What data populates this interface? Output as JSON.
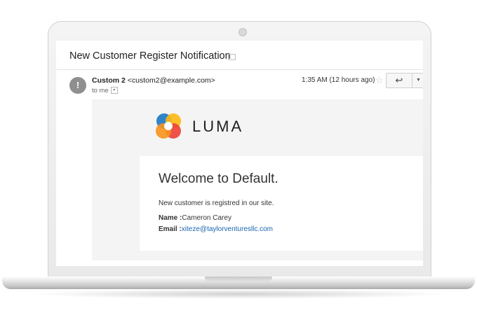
{
  "email": {
    "subject": "New Customer Register Notification",
    "label_icon": "label-icon",
    "avatar_icon": "exclamation-icon",
    "avatar_glyph": "!",
    "sender_name": "Custom 2",
    "sender_email": "<custom2@example.com>",
    "to_line": "to me",
    "time": "1:35 AM (12 hours ago)",
    "star_icon": "star-icon",
    "reply_icon": "reply-icon",
    "more_icon": "dropdown-caret-icon"
  },
  "body": {
    "logo_text": "LUMA",
    "logo_colors": [
      "#1979c3",
      "#f7941d",
      "#ee4036",
      "#8dc63f",
      "#fdb913"
    ],
    "welcome": "Welcome to Default.",
    "message": "New customer is registred in our site.",
    "name_label": "Name :",
    "name_value": "Cameron Carey",
    "email_label": "Email :",
    "email_value": "xiteze@taylorventuresllc.com"
  }
}
